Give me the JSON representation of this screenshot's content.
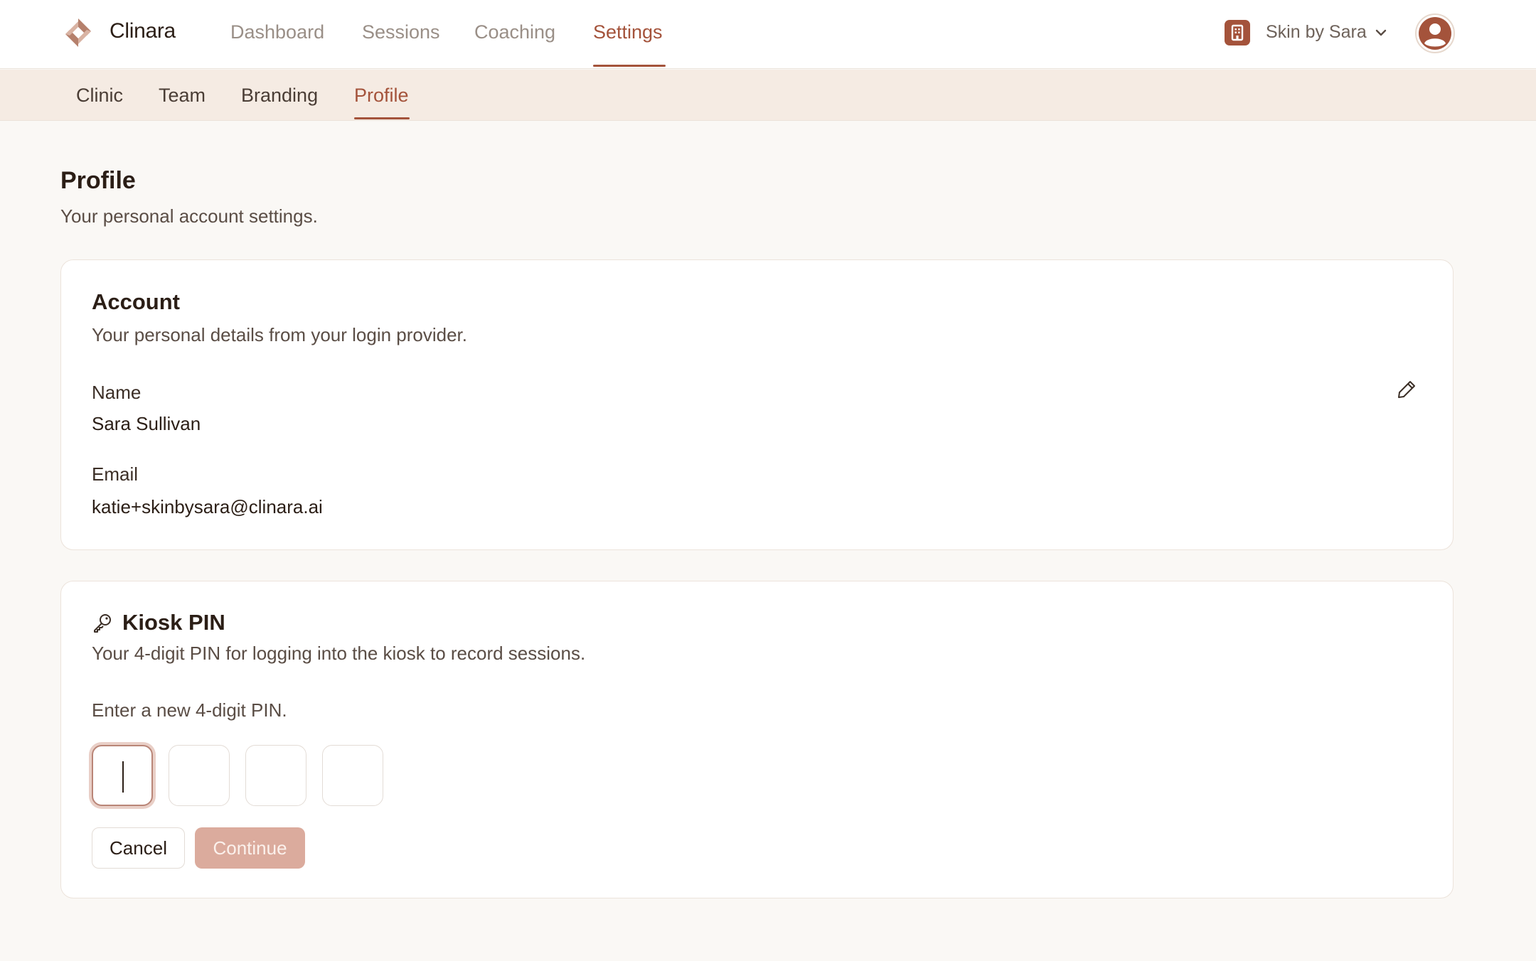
{
  "app": {
    "brand": "Clinara"
  },
  "nav": {
    "items": [
      {
        "label": "Dashboard",
        "active": false
      },
      {
        "label": "Sessions",
        "active": false
      },
      {
        "label": "Coaching",
        "active": false
      },
      {
        "label": "Settings",
        "active": true
      }
    ],
    "org_name": "Skin by Sara",
    "org_icon": "building-icon",
    "avatar_icon": "user-avatar-icon"
  },
  "subnav": {
    "items": [
      {
        "label": "Clinic",
        "active": false
      },
      {
        "label": "Team",
        "active": false
      },
      {
        "label": "Branding",
        "active": false
      },
      {
        "label": "Profile",
        "active": true
      }
    ]
  },
  "page": {
    "title": "Profile",
    "subtitle": "Your personal account settings."
  },
  "account": {
    "title": "Account",
    "description": "Your personal details from your login provider.",
    "name_label": "Name",
    "name_value": "Sara Sullivan",
    "email_label": "Email",
    "email_value": "katie+skinbysara@clinara.ai",
    "edit_icon": "pencil-icon"
  },
  "kiosk": {
    "title": "Kiosk PIN",
    "icon": "key-icon",
    "description": "Your 4-digit PIN for logging into the kiosk to record sessions.",
    "prompt": "Enter a new 4-digit PIN.",
    "pin_digits": [
      "",
      "",
      "",
      ""
    ],
    "cancel_label": "Cancel",
    "continue_label": "Continue"
  },
  "colors": {
    "accent": "#a4533b",
    "continue_disabled": "#dbab9d",
    "subnav_bg": "#f5ebe3",
    "page_bg": "#faf8f5"
  }
}
